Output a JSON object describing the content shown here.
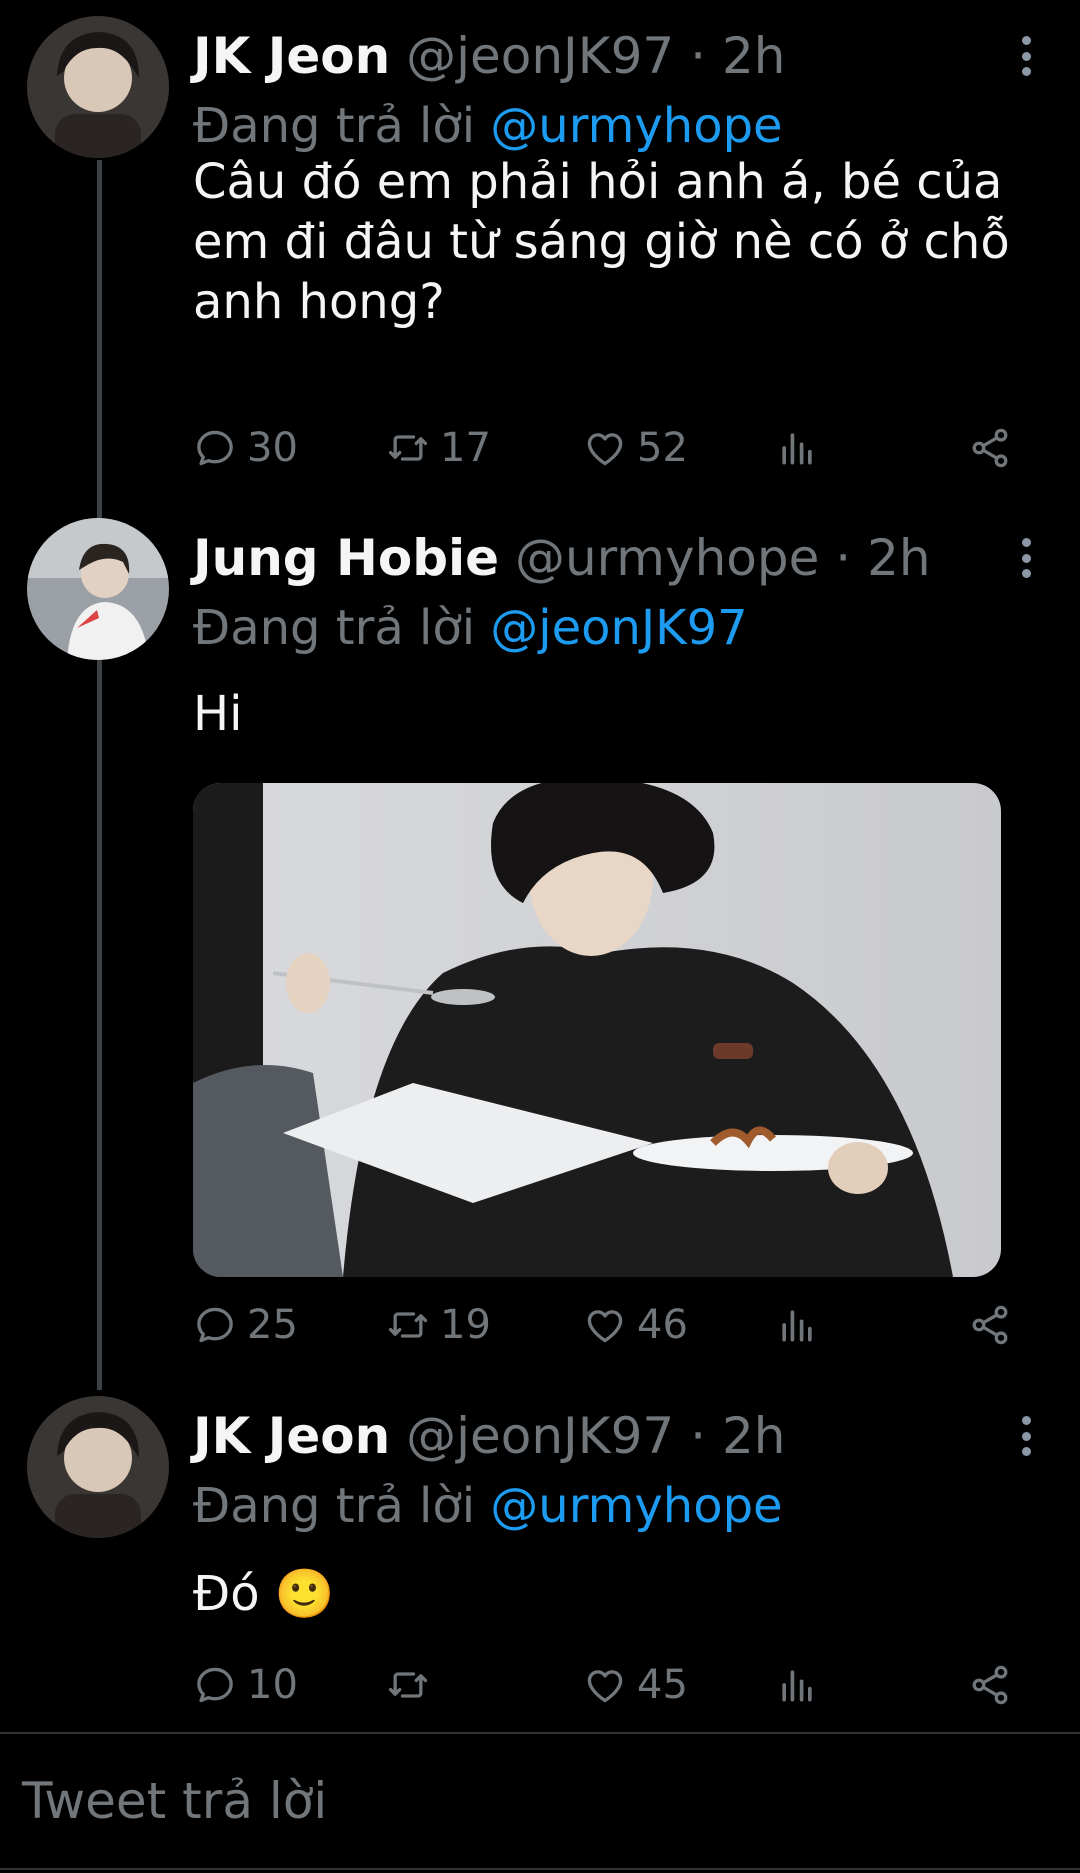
{
  "tweets": [
    {
      "name": "JK Jeon",
      "handle": "@jeonJK97",
      "dot": "·",
      "time": "2h",
      "reply_prefix": "Đang trả lời",
      "reply_handle": "@urmyhope",
      "text": "Câu đó em phải hỏi anh á, bé của em đi đâu từ sáng giờ nè có ở chỗ anh hong?",
      "replies": "30",
      "retweets": "17",
      "likes": "52"
    },
    {
      "name": "Jung Hobie",
      "handle": "@urmyhope",
      "dot": "·",
      "time": "2h",
      "reply_prefix": "Đang trả lời",
      "reply_handle": "@jeonJK97",
      "text": "Hi",
      "replies": "25",
      "retweets": "19",
      "likes": "46"
    },
    {
      "name": "JK Jeon",
      "handle": "@jeonJK97",
      "dot": "·",
      "time": "2h",
      "reply_prefix": "Đang trả lời",
      "reply_handle": "@urmyhope",
      "text": "Đó 🙂",
      "replies": "10",
      "retweets": "",
      "likes": "45"
    }
  ],
  "composer": {
    "placeholder": "Tweet trả lời"
  },
  "colors": {
    "accent": "#1d9bf0",
    "muted": "#71767b",
    "background": "#000000"
  },
  "icons": [
    "reply-icon",
    "retweet-icon",
    "like-icon",
    "views-icon",
    "share-icon",
    "more-icon"
  ]
}
